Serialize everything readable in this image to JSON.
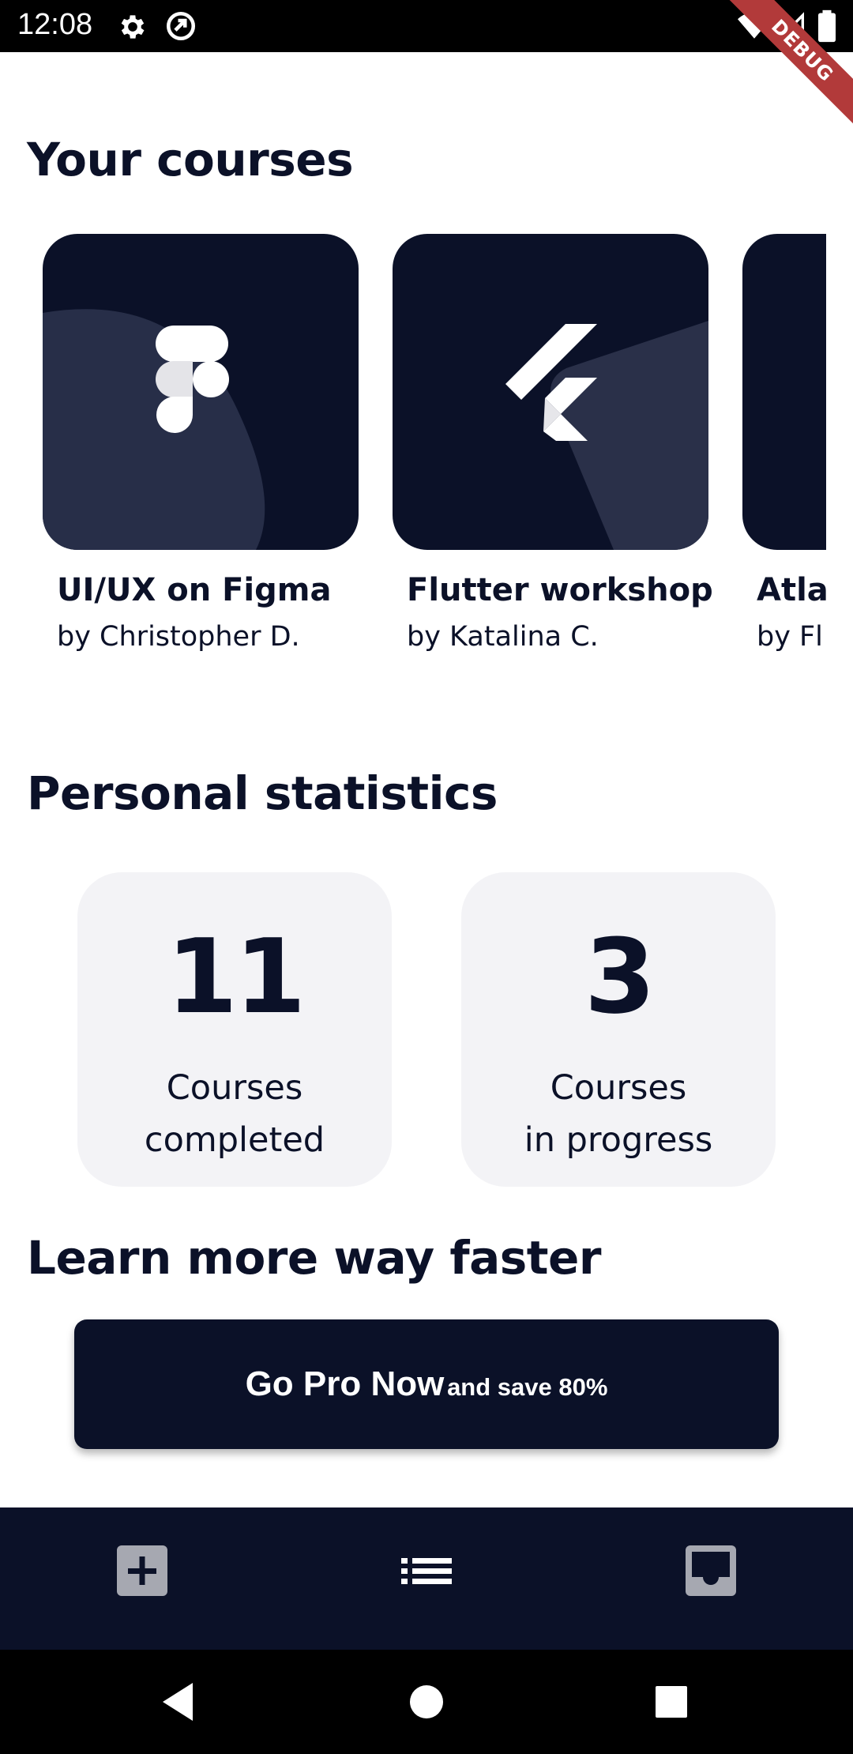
{
  "status_bar": {
    "time": "12:08",
    "icons": [
      "gear-icon",
      "sync-icon",
      "wifi-icon",
      "signal-icon",
      "battery-icon"
    ]
  },
  "debug_banner": "DEBUG",
  "courses_section": {
    "title": "Your courses",
    "courses": [
      {
        "title": "UI/UX on Figma",
        "author": "by Christopher D.",
        "icon": "figma-logo-icon"
      },
      {
        "title": "Flutter workshop",
        "author": "by Katalina C.",
        "icon": "flutter-logo-icon"
      },
      {
        "title": "Atla",
        "author": "by Fl",
        "icon": ""
      }
    ]
  },
  "stats_section": {
    "title": "Personal statistics",
    "stats": [
      {
        "value": "11",
        "label_line1": "Courses",
        "label_line2": "completed"
      },
      {
        "value": "3",
        "label_line1": "Courses",
        "label_line2": "in progress"
      }
    ]
  },
  "pro_section": {
    "title": "Learn more way faster",
    "button_main": "Go Pro Now",
    "button_sub": "and save 80%"
  },
  "bottom_nav": {
    "items": [
      "add-box-icon",
      "list-icon",
      "inbox-icon"
    ]
  },
  "system_nav": {
    "items": [
      "back-icon",
      "home-icon",
      "recents-icon"
    ]
  },
  "colors": {
    "primary_dark": "#0b1128",
    "stat_card_bg": "#f3f3f6",
    "debug_ribbon": "#b23a3a",
    "nav_icon": "#a6a8b1"
  }
}
